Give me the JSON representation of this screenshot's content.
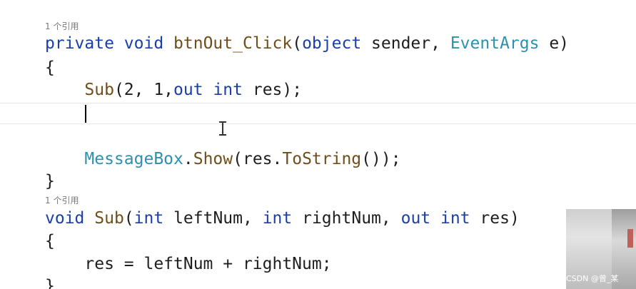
{
  "editor": {
    "codelens_1": "1 个引用",
    "codelens_2": "1 个引用",
    "line1": {
      "kw_private": "private",
      "kw_void": "void",
      "method_name": "btnOut_Click",
      "paren_open": "(",
      "kw_object": "object",
      "param_sender": "sender,",
      "type_eventargs": "EventArgs",
      "param_e": "e)"
    },
    "line2": {
      "brace": "{"
    },
    "line3": {
      "indent": "    ",
      "method": "Sub",
      "args": "(2, 1,",
      "kw_out": "out",
      "kw_int": "int",
      "rest": "res);"
    },
    "line5": {
      "indent": "    ",
      "type_messagebox": "MessageBox",
      "dot": ".",
      "method_show": "Show",
      "paren_open": "(res.",
      "method_tostring": "ToString",
      "rest": "());"
    },
    "line6": {
      "brace": "}"
    },
    "line7": {
      "kw_void": "void",
      "method_sub": "Sub",
      "paren_open": "(",
      "kw_int1": "int",
      "param_left": "leftNum,",
      "kw_int2": "int",
      "param_right": "rightNum,",
      "kw_out": "out",
      "kw_int3": "int",
      "param_res": "res)"
    },
    "line8": {
      "brace": "{"
    },
    "line9": {
      "indent": "    ",
      "expr": "res = leftNum + rightNum;"
    },
    "line10": {
      "brace": "}"
    }
  },
  "watermark": "CSDN @曾_某"
}
